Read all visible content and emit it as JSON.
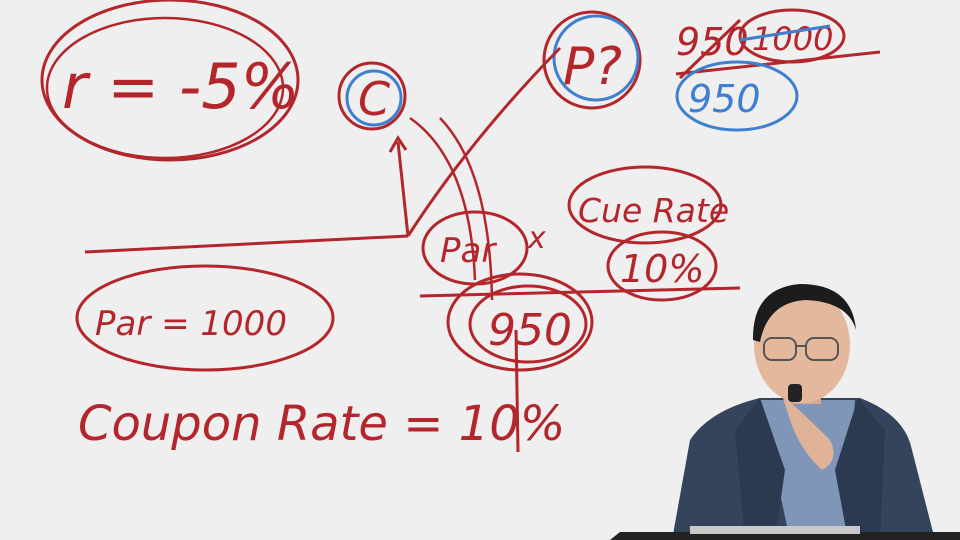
{
  "scene": "whiteboard-lecture",
  "colors": {
    "board": "#efefef",
    "red_ink": "#b3262c",
    "blue_ink": "#3f7fcf",
    "suit": "#34445c",
    "shirt": "#7f96b8",
    "skin": "#e3b89d",
    "hair": "#1c1c1c",
    "desk": "#222222"
  },
  "annotations": {
    "rate_change": "r = -5%",
    "c_label": "C",
    "p_label": "P?",
    "price_old": "950",
    "price_new": "1000",
    "price_circled": "950",
    "par_label": "Par",
    "times_sign": "x",
    "cue_rate": "Cue Rate",
    "ten_percent": "10%",
    "price_center": "950",
    "par_equation": "Par = 1000",
    "coupon_equation": "Coupon Rate = 10%"
  },
  "presenter": {
    "holding": "microphone"
  }
}
